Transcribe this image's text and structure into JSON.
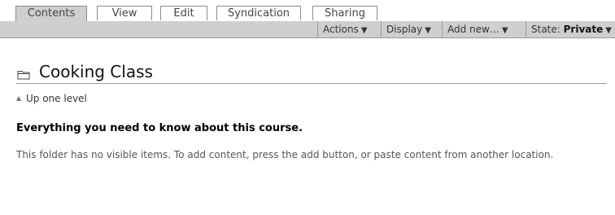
{
  "tabs": [
    {
      "label": "Contents"
    },
    {
      "label": "View"
    },
    {
      "label": "Edit"
    },
    {
      "label": "Syndication"
    },
    {
      "label": "Sharing"
    }
  ],
  "actions": {
    "actions_label": "Actions",
    "display_label": "Display",
    "add_new_label": "Add new…",
    "state_prefix": "State: ",
    "state_value": "Private"
  },
  "page": {
    "title": "Cooking Class",
    "up_one_level": "Up one level",
    "description": "Everything you need to know about this course.",
    "empty_message": "This folder has no visible items. To add content, press the add button, or paste content from another location."
  },
  "icons": {
    "arrow": "down-triangle-icon",
    "folder": "folder-icon",
    "up": "up-triangle-icon"
  }
}
